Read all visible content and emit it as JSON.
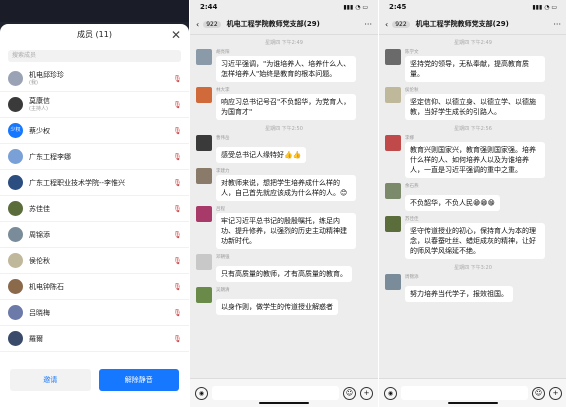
{
  "panel1": {
    "sheet_title": "成员 (11)",
    "close": "✕",
    "search_placeholder": "搜索成员",
    "members": [
      {
        "name": "机电邱珍珍",
        "sub": "(我)",
        "avatar_color": "#9aa3b5"
      },
      {
        "name": "莫康信",
        "sub": "(主持人)",
        "avatar_color": "#3a3a3a"
      },
      {
        "name": "蔡少权",
        "sub": "",
        "avatar_color": "#1677ff",
        "avatar_text": "少权"
      },
      {
        "name": "广东工程李娜",
        "sub": "",
        "avatar_color": "#7aa0d8"
      },
      {
        "name": "广东工程职业技术学院--李惟兴",
        "sub": "",
        "avatar_color": "#2b4d80"
      },
      {
        "name": "苏佳佳",
        "sub": "",
        "avatar_color": "#5a6d3a"
      },
      {
        "name": "周锦添",
        "sub": "",
        "avatar_color": "#7a8c9a"
      },
      {
        "name": "侯伦秋",
        "sub": "",
        "avatar_color": "#c0b89a"
      },
      {
        "name": "机电钟陈石",
        "sub": "",
        "avatar_color": "#8a6a4a"
      },
      {
        "name": "吕晓梅",
        "sub": "",
        "avatar_color": "#6b7aa8"
      },
      {
        "name": "羅爾",
        "sub": "",
        "avatar_color": "#3a4a6a"
      }
    ],
    "invite_label": "邀请",
    "unmute_label": "解除静音"
  },
  "panel2": {
    "time": "2:44",
    "badge": "922",
    "title": "机电工程学院教师党支部(29)",
    "messages": [
      {
        "kind": "time",
        "text": "星期四 下午2:49"
      },
      {
        "kind": "msg",
        "sender": "胡亮阳",
        "text": "习近平强调，\"为谁培养人、培养什么人、怎样培养人\"始终是教育的根本问题。",
        "avatar_color": "#8a9aa8"
      },
      {
        "kind": "msg",
        "sender": "林大李",
        "text": "响应习总书记号召\"不负韶华，为党育人，为国育才\"",
        "avatar_color": "#d06a3a"
      },
      {
        "kind": "time",
        "text": "星期四 下午2:50"
      },
      {
        "kind": "msg",
        "sender": "曹伟岳",
        "text": "感受总书记人缘特好👍👍",
        "avatar_color": "#3a3a3a"
      },
      {
        "kind": "msg",
        "sender": "李建力",
        "text": "对教师来说，想把学生培养成什么样的人，自己首先就应该成为什么样的人。😊",
        "avatar_color": "#8a7a6a"
      },
      {
        "kind": "msg",
        "sender": "吕程",
        "text": "牢记习近平总书记的殷殷嘱托，练足内功、提升修养，以强烈的历史主动精神建功新时代。",
        "avatar_color": "#a83a6a"
      },
      {
        "kind": "msg",
        "sender": "邓朝强",
        "text": "只有高质量的教师，才有高质量的教育。",
        "avatar_color": "#c8c8c8"
      },
      {
        "kind": "msg",
        "sender": "吴朗清",
        "text": "以身作则，做学生的传道授业解惑者",
        "avatar_color": "#6a8a4a"
      }
    ]
  },
  "panel3": {
    "time": "2:45",
    "badge": "922",
    "title": "机电工程学院教师党支部(29)",
    "messages": [
      {
        "kind": "time",
        "text": "星期四 下午2:49"
      },
      {
        "kind": "msg",
        "sender": "陈学文",
        "text": "坚持党的领导，无私奉献，提高教育质量。",
        "avatar_color": "#6a6a6a"
      },
      {
        "kind": "msg",
        "sender": "侯伦秋",
        "text": "坚定信仰、以德立身、以德立学、以德施教，当好学生成长的引路人。",
        "avatar_color": "#c0b89a"
      },
      {
        "kind": "time",
        "text": "星期四 下午2:56"
      },
      {
        "kind": "msg",
        "sender": "李娜",
        "text": "教育兴则国家兴，教育强则国家强。培养什么样的人、如何培养人以及为谁培养人，一直是习近平强调的重中之重。",
        "avatar_color": "#c04a4a"
      },
      {
        "kind": "msg",
        "sender": "余石燕",
        "text": "不负韶华，不负人民😁😁😁",
        "avatar_color": "#7a8a6a"
      },
      {
        "kind": "msg",
        "sender": "苏佳佳",
        "text": "坚守传道授业的初心，保持育人为本的理念，以春蚕吐丝、蜡炬成灰的精神，让好的师风学风绵延不绝。",
        "avatar_color": "#5a6d3a"
      },
      {
        "kind": "time",
        "text": "星期四 下午3:20"
      },
      {
        "kind": "msg",
        "sender": "周锦添",
        "text": "努力培养当代学子，报效祖国。",
        "avatar_color": "#7a8c9a"
      }
    ]
  },
  "icons": {
    "back": "‹",
    "more": "···",
    "voice": "◉",
    "emoji": "☺",
    "plus": "+"
  }
}
